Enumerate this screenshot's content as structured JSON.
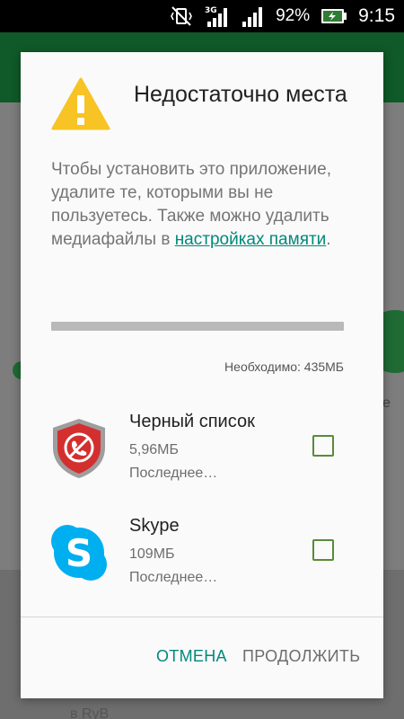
{
  "status_bar": {
    "network_type": "3G",
    "battery_percent": "92%",
    "time": "9:15"
  },
  "background": {
    "bottom_text": "в RyB",
    "partial_letter": "e"
  },
  "dialog": {
    "title": "Недостаточно места",
    "icon": "warning-icon",
    "message_before_link": "Чтобы установить это приложение, удалите те, которыми вы не пользуетесь. Также можно удалить медиафайлы в ",
    "message_link": "настройках памяти",
    "message_after_link": ".",
    "storage_progress": 0,
    "required_label": "Необходимо: 435МБ",
    "apps": [
      {
        "name": "Черный список",
        "size": "5,96МБ",
        "last_used": "Последнее…",
        "icon": "blocked-call-shield-icon",
        "checked": false
      },
      {
        "name": "Skype",
        "size": "109МБ",
        "last_used": "Последнее…",
        "icon": "skype-icon",
        "checked": false
      }
    ],
    "cancel_label": "ОТМЕНА",
    "continue_label": "ПРОДОЛЖИТЬ"
  },
  "colors": {
    "accent": "#00897b",
    "warning": "#f7c325",
    "checkbox": "#5a8a3a",
    "app_bar": "#0f5a28"
  }
}
